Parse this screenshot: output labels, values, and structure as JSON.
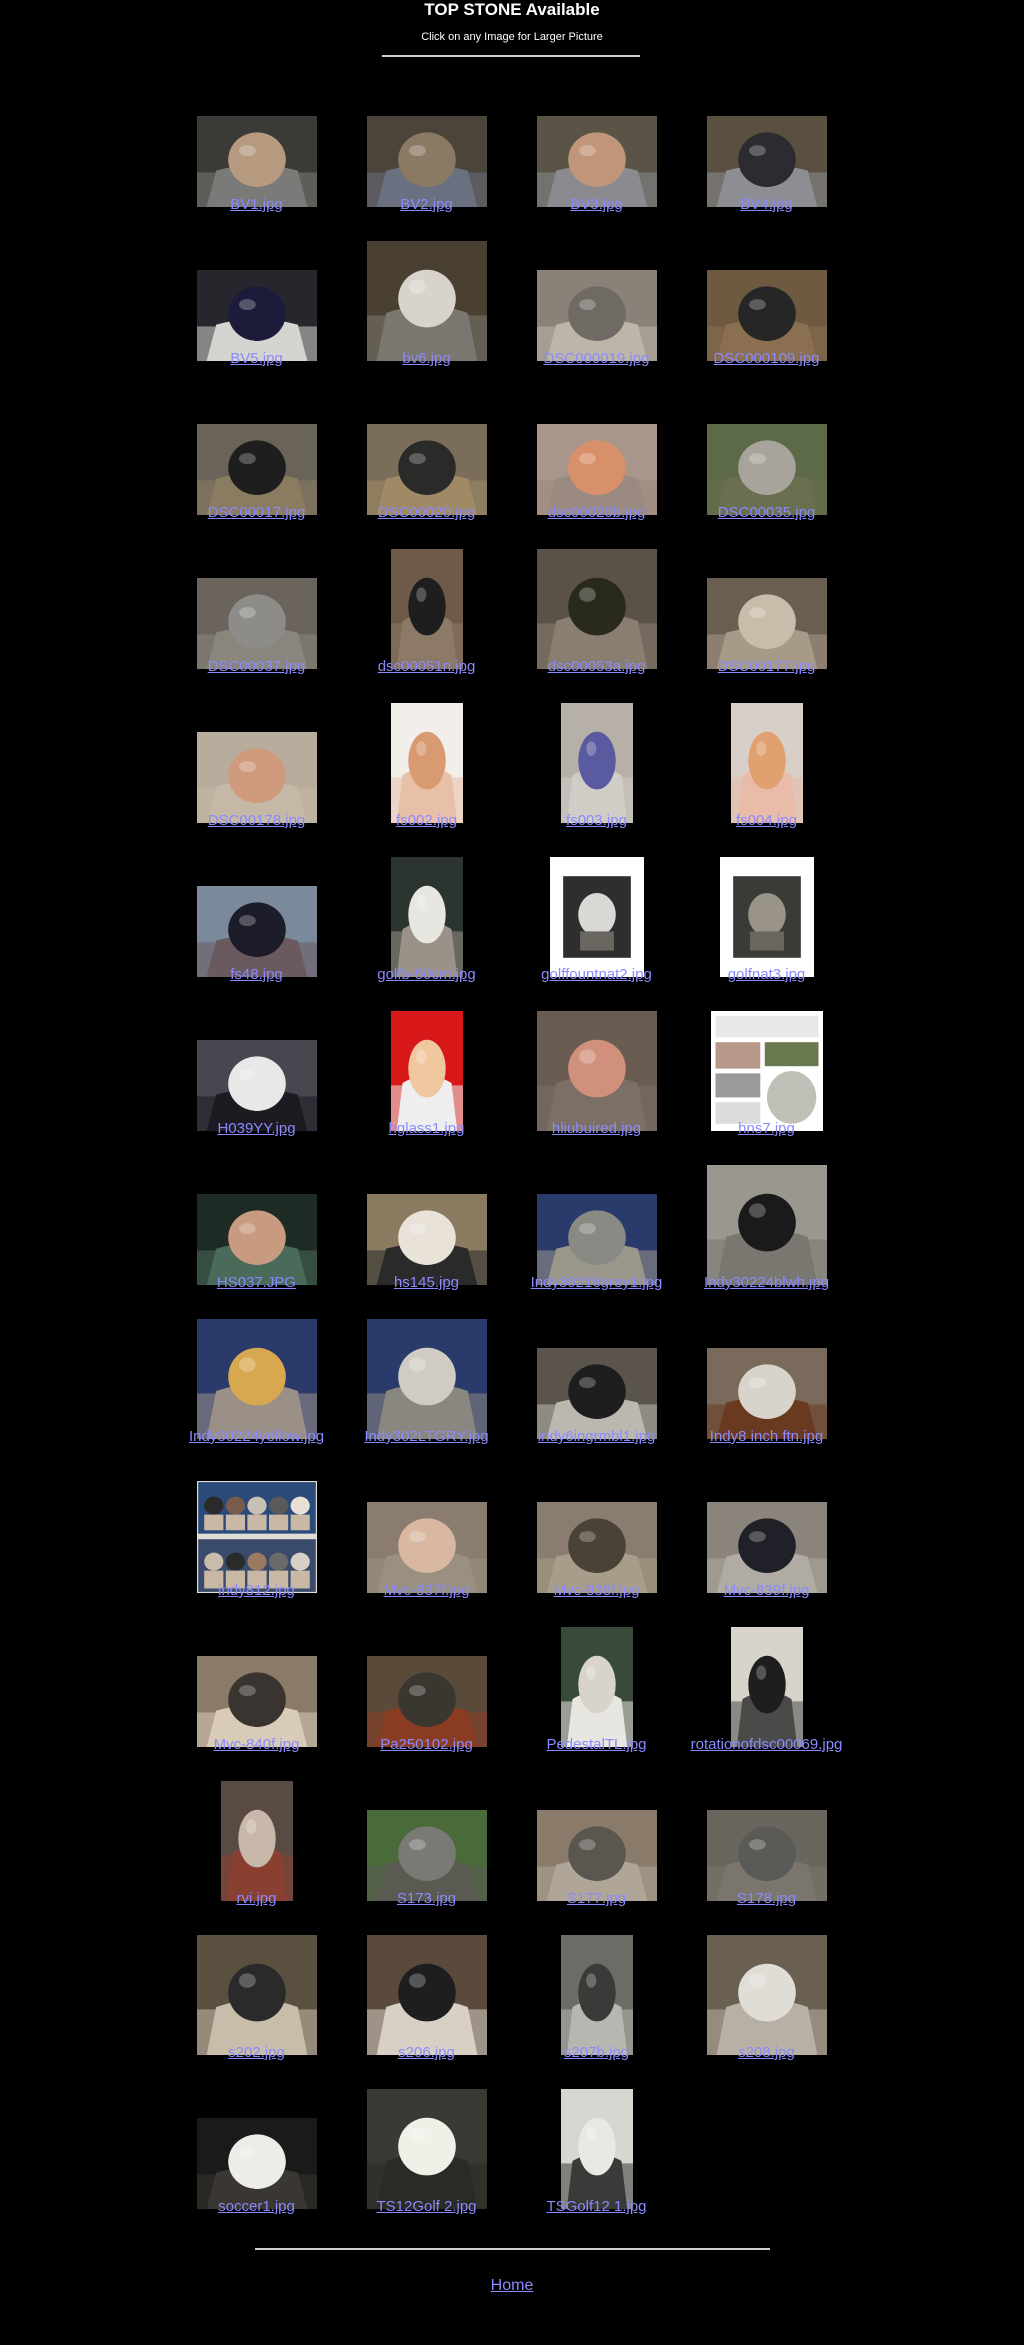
{
  "header": {
    "title": "TOP STONE Available",
    "subtitle": "Click on any Image for Larger Picture"
  },
  "gallery": {
    "items": [
      {
        "caption": "BV1.jpg",
        "shape": "wide",
        "bg": "#3c3a36",
        "ball": "#b59a80",
        "base": "#7a7a78"
      },
      {
        "caption": "BV2.jpg",
        "shape": "wide",
        "bg": "#4a443a",
        "ball": "#8a7a64",
        "base": "#6b7080"
      },
      {
        "caption": "BV3.jpg",
        "shape": "wide",
        "bg": "#5a5446",
        "ball": "#c0957a",
        "base": "#8a8a90"
      },
      {
        "caption": "BV4.jpg",
        "shape": "wide",
        "bg": "#5a5040",
        "ball": "#2c2c30",
        "base": "#8d8e94"
      },
      {
        "caption": "BV5.jpg",
        "shape": "wide",
        "bg": "#26262c",
        "ball": "#1c1c3a",
        "base": "#d6d4d0"
      },
      {
        "caption": "bv6.jpg",
        "shape": "square",
        "bg": "#4a4032",
        "ball": "#d8d4cc",
        "base": "#7a7670"
      },
      {
        "caption": "DSC000019.jpg",
        "shape": "wide",
        "bg": "#8a8278",
        "ball": "#6f6a64",
        "base": "#bdb6a8"
      },
      {
        "caption": "DSC000109.jpg",
        "shape": "wide",
        "bg": "#6d5a40",
        "ball": "#262626",
        "base": "#8a7050"
      },
      {
        "caption": "DSC00017.jpg",
        "shape": "wide",
        "bg": "#6a6458",
        "ball": "#1e1e1e",
        "base": "#8a7c60"
      },
      {
        "caption": "DSC00020.jpg",
        "shape": "wide",
        "bg": "#7a6e5a",
        "ball": "#2a2a28",
        "base": "#a08a66"
      },
      {
        "caption": "dsc00020b.jpg",
        "shape": "wide",
        "bg": "#a9968a",
        "ball": "#d8906a",
        "base": "#9a8a80"
      },
      {
        "caption": "DSC00035.jpg",
        "shape": "wide",
        "bg": "#5c6a48",
        "ball": "#a8a49c",
        "base": "#6a6f50"
      },
      {
        "caption": "DSC00037.jpg",
        "shape": "wide",
        "bg": "#6a645c",
        "ball": "#8e8c88",
        "base": "#8a867e"
      },
      {
        "caption": "dsc00051n.jpg",
        "shape": "tall",
        "bg": "#6e5a48",
        "ball": "#1e1e1e",
        "base": "#8c7a66"
      },
      {
        "caption": "dsc00053a.jpg",
        "shape": "square",
        "bg": "#5a5248",
        "ball": "#2a2a1c",
        "base": "#8a7e70"
      },
      {
        "caption": "DSC00177.jpg",
        "shape": "wide",
        "bg": "#6a5e50",
        "ball": "#c8bcaa",
        "base": "#a89a88"
      },
      {
        "caption": "DSC00178.jpg",
        "shape": "wide",
        "bg": "#b8ac9c",
        "ball": "#d09a7c",
        "base": "#c6b8a6"
      },
      {
        "caption": "fs002.jpg",
        "shape": "tall",
        "bg": "#f2eeea",
        "ball": "#d89a70",
        "base": "#e8c0a8"
      },
      {
        "caption": "fs003.jpg",
        "shape": "tall",
        "bg": "#b6b0a8",
        "ball": "#5a5aa0",
        "base": "#d0ccc6"
      },
      {
        "caption": "fs004.jpg",
        "shape": "tall",
        "bg": "#d8d0c8",
        "ball": "#e0a070",
        "base": "#e8bca8"
      },
      {
        "caption": "fs48.jpg",
        "shape": "wide",
        "bg": "#7a8a9a",
        "ball": "#1c1c2a",
        "base": "#6a5a60"
      },
      {
        "caption": "golfb-50cm.jpg",
        "shape": "tall",
        "bg": "#2c3430",
        "ball": "#e8e6e0",
        "base": "#9a9288"
      },
      {
        "caption": "golffountnat2.jpg",
        "shape": "framed",
        "bg": "#ffffff",
        "ball": "#d8d8d4",
        "base": "#2e2e2e"
      },
      {
        "caption": "golfnat3.jpg",
        "shape": "framed",
        "bg": "#ffffff",
        "ball": "#9a9488",
        "base": "#3a3a36"
      },
      {
        "caption": "H039YY.jpg",
        "shape": "wide",
        "bg": "#4a4650",
        "ball": "#e8e8e8",
        "base": "#1e1a22"
      },
      {
        "caption": "hglass1.jpg",
        "shape": "tall",
        "bg": "#d81818",
        "ball": "#f0c8a0",
        "base": "#eeeeee"
      },
      {
        "caption": "hliubuired.jpg",
        "shape": "square",
        "bg": "#6a5c50",
        "ball": "#d0907c",
        "base": "#7c7066"
      },
      {
        "caption": "hns7.jpg",
        "shape": "doc",
        "bg": "#ffffff",
        "ball": "#b89888",
        "base": "#6a7a50"
      },
      {
        "caption": "HS037.JPG",
        "shape": "wide",
        "bg": "#1e2a24",
        "ball": "#c89a80",
        "base": "#4a6a5a"
      },
      {
        "caption": "hs145.jpg",
        "shape": "wide",
        "bg": "#8a7a60",
        "ball": "#e8e2d8",
        "base": "#2a2a2a"
      },
      {
        "caption": "Indy30216grey1.jpg",
        "shape": "wide",
        "bg": "#2a3a6a",
        "ball": "#8a8a84",
        "base": "#9a968a"
      },
      {
        "caption": "Indy30224blwh.jpg",
        "shape": "square",
        "bg": "#9a9690",
        "ball": "#1a1a1a",
        "base": "#7a7670"
      },
      {
        "caption": "Indy30224yellow.jpg",
        "shape": "square",
        "bg": "#2a3a6a",
        "ball": "#d8a850",
        "base": "#9a9088"
      },
      {
        "caption": "Indy302LTGRY.jpg",
        "shape": "square",
        "bg": "#2a3a6a",
        "ball": "#d0ccc4",
        "base": "#8a8680"
      },
      {
        "caption": "indy6ingrmbl1.jpg",
        "shape": "wide",
        "bg": "#5a544c",
        "ball": "#1e1e1e",
        "base": "#bcb8b0"
      },
      {
        "caption": "Indy8 inch ftn.jpg",
        "shape": "wide",
        "bg": "#7a6a5c",
        "ball": "#d8d4cc",
        "base": "#6a3a20"
      },
      {
        "caption": "indy812.jpg",
        "shape": "collage",
        "bg": "#2a4a7a",
        "ball": "#8a7a6a",
        "base": "#c8b8a4"
      },
      {
        "caption": "Mvc-837f.jpg",
        "shape": "wide",
        "bg": "#8a7c6e",
        "ball": "#d8b8a0",
        "base": "#9a9080"
      },
      {
        "caption": "Mvc-838f.jpg",
        "shape": "wide",
        "bg": "#8a7c6e",
        "ball": "#4a4236",
        "base": "#a89c8a"
      },
      {
        "caption": "Mvc-839f.jpg",
        "shape": "wide",
        "bg": "#8a847c",
        "ball": "#202028",
        "base": "#b0aca4"
      },
      {
        "caption": "Mvc-840f.jpg",
        "shape": "wide",
        "bg": "#8a7a68",
        "ball": "#3a3430",
        "base": "#d8ccb8"
      },
      {
        "caption": "Pa250102.jpg",
        "shape": "wide",
        "bg": "#5a4a3a",
        "ball": "#3a3630",
        "base": "#8a3c22"
      },
      {
        "caption": "PedestalTL.jpg",
        "shape": "tall",
        "bg": "#3a4a3a",
        "ball": "#d8d4cc",
        "base": "#e8e6e0"
      },
      {
        "caption": "rotationofdsc00069.jpg",
        "shape": "tall",
        "bg": "#d8d4cc",
        "ball": "#1e1e1e",
        "base": "#4a4a48"
      },
      {
        "caption": "rvi.jpg",
        "shape": "tall",
        "bg": "#5a4a44",
        "ball": "#c8b8aa",
        "base": "#8a4030"
      },
      {
        "caption": "S173.jpg",
        "shape": "wide",
        "bg": "#4a6a3a",
        "ball": "#7a7a74",
        "base": "#5a5a52"
      },
      {
        "caption": "S177.jpg",
        "shape": "wide",
        "bg": "#8a7a6a",
        "ball": "#5a5650",
        "base": "#b0a698"
      },
      {
        "caption": "S178.jpg",
        "shape": "wide",
        "bg": "#6a665e",
        "ball": "#5a5a56",
        "base": "#7a766e"
      },
      {
        "caption": "s202.jpg",
        "shape": "square",
        "bg": "#5a5040",
        "ball": "#2a2a2a",
        "base": "#c8bcaa"
      },
      {
        "caption": "s206.jpg",
        "shape": "square",
        "bg": "#5a4a3c",
        "ball": "#1e1e1e",
        "base": "#d8d0c4"
      },
      {
        "caption": "s207b.jpg",
        "shape": "tall",
        "bg": "#6a6c66",
        "ball": "#3a3a38",
        "base": "#b8b6b0"
      },
      {
        "caption": "s208.jpg",
        "shape": "square",
        "bg": "#6a6052",
        "ball": "#e0dcd6",
        "base": "#b8b0a4"
      },
      {
        "caption": "soccer1.jpg",
        "shape": "wide",
        "bg": "#1a1a1a",
        "ball": "#ecece8",
        "base": "#3a3632"
      },
      {
        "caption": "TS12Golf 2.jpg",
        "shape": "square",
        "bg": "#3a3a34",
        "ball": "#f0efe8",
        "base": "#2a2a26"
      },
      {
        "caption": "TSGolf12 1.jpg",
        "shape": "tall",
        "bg": "#d8d6d0",
        "ball": "#e8e8e4",
        "base": "#3a3a38"
      }
    ]
  },
  "footer": {
    "home_label": "Home"
  }
}
